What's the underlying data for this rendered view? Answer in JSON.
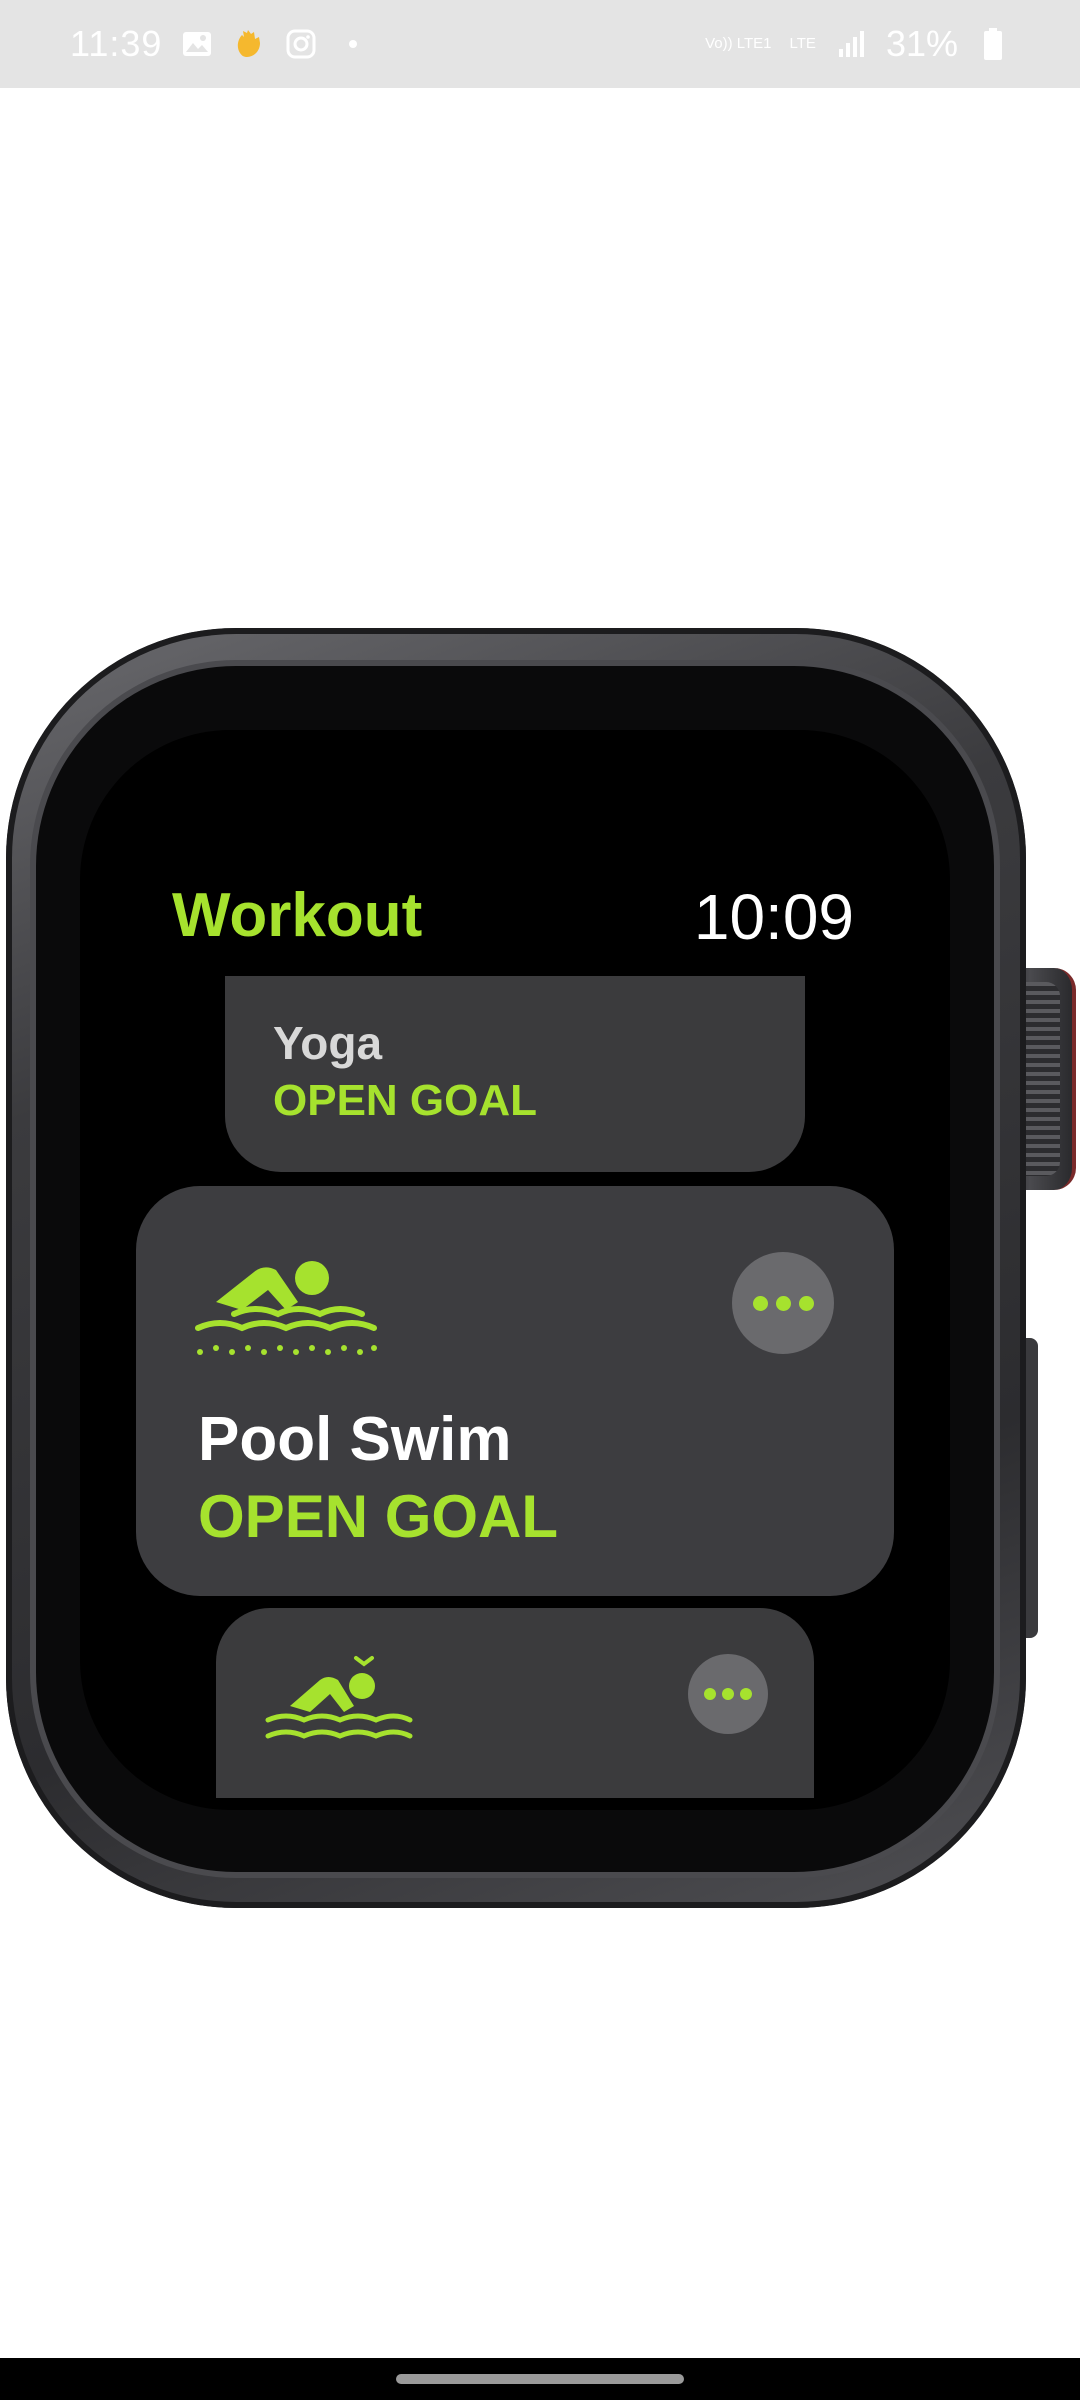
{
  "status_bar": {
    "time": "11:39",
    "icons": [
      "gallery-icon",
      "wave-emoji-icon",
      "instagram-icon",
      "dot-icon"
    ],
    "network_labels": [
      "Vo)) LTE1",
      "LTE"
    ],
    "battery": "31%"
  },
  "watch": {
    "app_title": "Workout",
    "time": "10:09",
    "workouts": [
      {
        "name": "Yoga",
        "goal": "OPEN GOAL",
        "icon": "yoga-icon"
      },
      {
        "name": "Pool Swim",
        "goal": "OPEN GOAL",
        "icon": "pool-swim-icon"
      },
      {
        "name": "",
        "goal": "",
        "icon": "open-water-swim-icon"
      }
    ]
  },
  "colors": {
    "accent": "#a6e22e",
    "card": "#3b3b3d",
    "screen": "#000000"
  }
}
